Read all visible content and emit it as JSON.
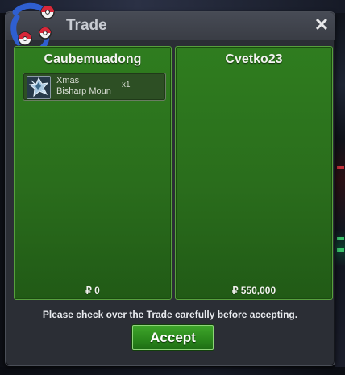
{
  "window": {
    "title": "Trade",
    "close_label": "✕"
  },
  "background": {
    "top_text": " "
  },
  "panels": [
    {
      "player": "Caubemuadong",
      "items": [
        {
          "name": "Xmas\nBisharp Moun",
          "qty": "x1",
          "icon": "bisharp-mount-icon"
        }
      ],
      "money": "₽ 0"
    },
    {
      "player": "Cvetko23",
      "items": [],
      "money": "₽ 550,000"
    }
  ],
  "notice": "Please check over the Trade carefully before accepting.",
  "accept_label": "Accept",
  "colors": {
    "panel_green": "#2a6d1c",
    "accept_green": "#2c8a1d",
    "window_bg": "#2b2e35"
  }
}
